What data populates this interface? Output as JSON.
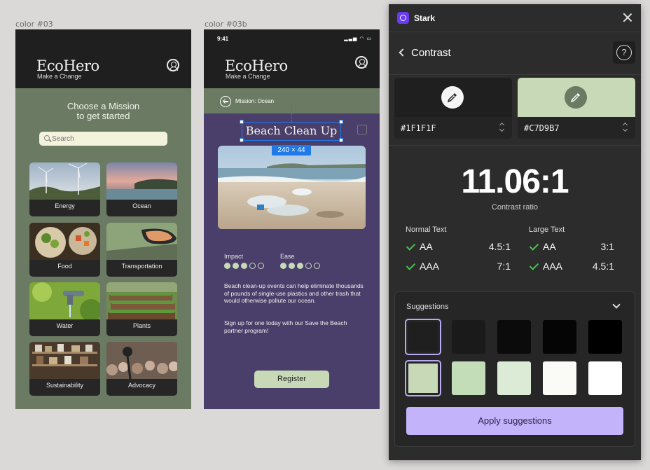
{
  "frames": {
    "frame1_label": "color #03",
    "frame2_label": "color #03b"
  },
  "app": {
    "logo_title": "EcoHero",
    "logo_subtitle": "Make a Change",
    "mission_heading_line1": "Choose a Mission",
    "mission_heading_line2": "to get started",
    "search_placeholder": "Search",
    "tiles": [
      "Energy",
      "Ocean",
      "Food",
      "Transportation",
      "Water",
      "Plants",
      "Sustainability",
      "Advocacy"
    ]
  },
  "detail": {
    "status_time": "9:41",
    "status_icons": "▂▃▅ ◠ ▭",
    "sub_nav_label": "Mission: Ocean",
    "title": "Beach Clean Up",
    "size_badge": "240 × 44",
    "impact_label": "Impact",
    "ease_label": "Ease",
    "impact_level": 3,
    "ease_level": 3,
    "dots_total": 5,
    "desc_1": "Beach clean-up events can help eliminate thousands of pounds of single-use plastics and other trash that would otherwise pollute our ocean.",
    "desc_2": "Sign up for one today with our Save the Beach partner program!",
    "register_label": "Register"
  },
  "stark": {
    "title": "Stark",
    "section": "Contrast",
    "help": "?",
    "fg_hex": "#1F1F1F",
    "bg_hex": "#C7D9B7",
    "ratio": "11.06:1",
    "ratio_label": "Contrast ratio",
    "normal_text": "Normal Text",
    "large_text": "Large Text",
    "normal": [
      {
        "level": "AA",
        "req": "4.5:1"
      },
      {
        "level": "AAA",
        "req": "7:1"
      }
    ],
    "large": [
      {
        "level": "AA",
        "req": "3:1"
      },
      {
        "level": "AAA",
        "req": "4.5:1"
      }
    ],
    "suggestions_title": "Suggestions",
    "suggest_row1": [
      "#1f1f1f",
      "#1a1a1a",
      "#0b0b0b",
      "#050505",
      "#000000"
    ],
    "suggest_row2": [
      "#c7d9b7",
      "#c2ddb8",
      "#dcebd6",
      "#fafaf7",
      "#ffffff"
    ],
    "apply_label": "Apply suggestions"
  },
  "colors": {
    "accent": "#c3b3fa",
    "pass": "#4bc04b",
    "selection": "#1f7ae8"
  }
}
